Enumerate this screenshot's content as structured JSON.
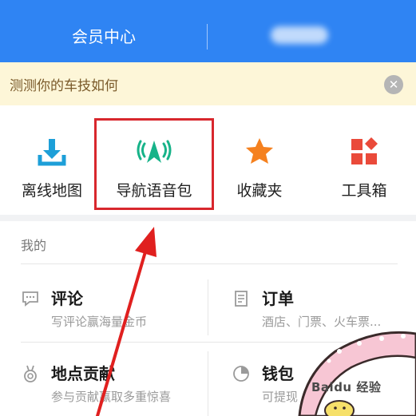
{
  "header": {
    "tab_member": "会员中心",
    "tab_second": ""
  },
  "banner": {
    "text": "测测你的车技如何",
    "close_glyph": "✕"
  },
  "tools": [
    {
      "label": "离线地图",
      "icon": "download-icon",
      "color": "#1d9fd8"
    },
    {
      "label": "导航语音包",
      "icon": "voice-navigation-icon",
      "color": "#17b389"
    },
    {
      "label": "收藏夹",
      "icon": "star-icon",
      "color": "#f5811f"
    },
    {
      "label": "工具箱",
      "icon": "toolbox-icon",
      "color": "#ea4a3a"
    }
  ],
  "mine": {
    "title": "我的",
    "items": [
      {
        "title": "评论",
        "subtitle": "写评论赢海量金币",
        "icon": "comment-icon"
      },
      {
        "title": "订单",
        "subtitle": "酒店、门票、火车票...",
        "icon": "order-icon"
      },
      {
        "title": "地点贡献",
        "subtitle": "参与贡献赢取多重惊喜",
        "icon": "medal-icon"
      },
      {
        "title": "钱包",
        "subtitle": "可提现",
        "icon": "wallet-icon"
      }
    ]
  },
  "watermark": "Baidu 经验",
  "colors": {
    "header_blue": "#2f84f3",
    "banner_bg": "#fdf6d8",
    "highlight_red": "#d8272d"
  }
}
